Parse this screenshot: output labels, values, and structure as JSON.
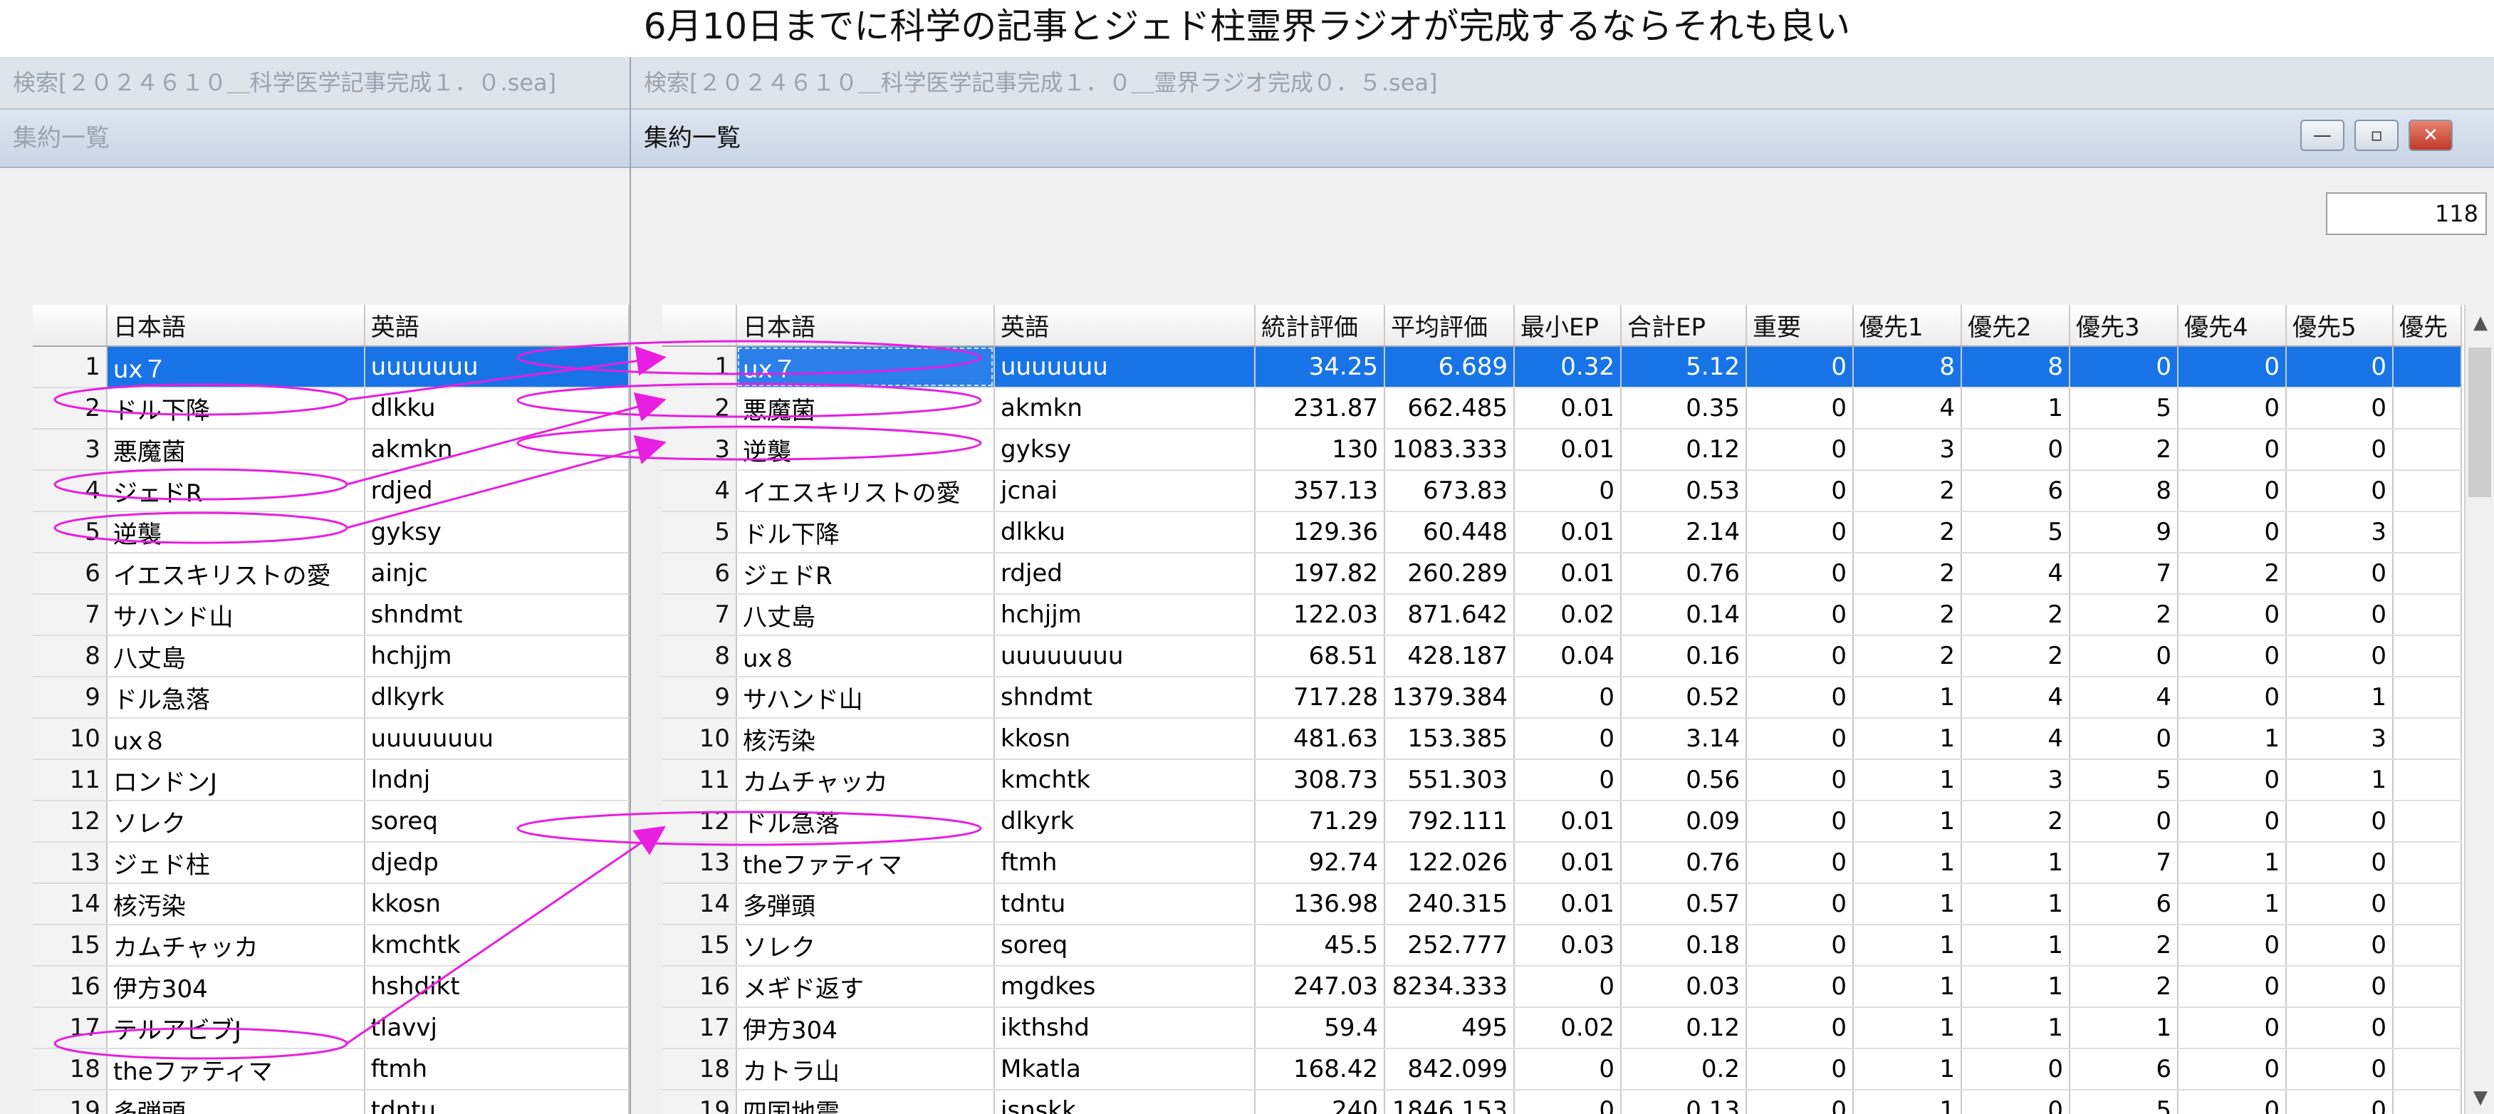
{
  "caption": "6月10日までに科学の記事とジェド柱霊界ラジオが完成するならそれも良い",
  "left_window": {
    "search_title": "検索[２０２４６１０＿科学医学記事完成１．０.sea]",
    "panel_title": "集約一覧",
    "columns": [
      "日本語",
      "英語"
    ],
    "rows": [
      {
        "n": "1",
        "jp": "ux７",
        "en": "uuuuuuu"
      },
      {
        "n": "2",
        "jp": "ドル下降",
        "en": "dlkku"
      },
      {
        "n": "3",
        "jp": "悪魔菌",
        "en": "akmkn"
      },
      {
        "n": "4",
        "jp": "ジェドR",
        "en": "rdjed"
      },
      {
        "n": "5",
        "jp": "逆襲",
        "en": "gyksy"
      },
      {
        "n": "6",
        "jp": "イエスキリストの愛",
        "en": "ainjc"
      },
      {
        "n": "7",
        "jp": "サハンド山",
        "en": "shndmt"
      },
      {
        "n": "8",
        "jp": "八丈島",
        "en": "hchjjm"
      },
      {
        "n": "9",
        "jp": "ドル急落",
        "en": "dlkyrk"
      },
      {
        "n": "10",
        "jp": "ux８",
        "en": "uuuuuuuu"
      },
      {
        "n": "11",
        "jp": "ロンドンJ",
        "en": "lndnj"
      },
      {
        "n": "12",
        "jp": "ソレク",
        "en": "soreq"
      },
      {
        "n": "13",
        "jp": "ジェド柱",
        "en": "djedp"
      },
      {
        "n": "14",
        "jp": "核汚染",
        "en": "kkosn"
      },
      {
        "n": "15",
        "jp": "カムチャッカ",
        "en": "kmchtk"
      },
      {
        "n": "16",
        "jp": "伊方304",
        "en": "hshdikt"
      },
      {
        "n": "17",
        "jp": "テルアビブJ",
        "en": "tlavvj"
      },
      {
        "n": "18",
        "jp": "theファティマ",
        "en": "ftmh"
      },
      {
        "n": "19",
        "jp": "多弾頭",
        "en": "tdntu"
      }
    ]
  },
  "right_window": {
    "search_title": "検索[２０２４６１０＿科学医学記事完成１．０＿霊界ラジオ完成０．５.sea]",
    "panel_title": "集約一覧",
    "count": "118",
    "columns": [
      "日本語",
      "英語",
      "統計評価",
      "平均評価",
      "最小EP",
      "合計EP",
      "重要",
      "優先1",
      "優先2",
      "優先3",
      "優先4",
      "優先5",
      "優先"
    ],
    "rows": [
      [
        "1",
        "ux７",
        "uuuuuuu",
        "34.25",
        "6.689",
        "0.32",
        "5.12",
        "0",
        "8",
        "8",
        "0",
        "0",
        "0"
      ],
      [
        "2",
        "悪魔菌",
        "akmkn",
        "231.87",
        "662.485",
        "0.01",
        "0.35",
        "0",
        "4",
        "1",
        "5",
        "0",
        "0"
      ],
      [
        "3",
        "逆襲",
        "gyksy",
        "130",
        "1083.333",
        "0.01",
        "0.12",
        "0",
        "3",
        "0",
        "2",
        "0",
        "0"
      ],
      [
        "4",
        "イエスキリストの愛",
        "jcnai",
        "357.13",
        "673.83",
        "0",
        "0.53",
        "0",
        "2",
        "6",
        "8",
        "0",
        "0"
      ],
      [
        "5",
        "ドル下降",
        "dlkku",
        "129.36",
        "60.448",
        "0.01",
        "2.14",
        "0",
        "2",
        "5",
        "9",
        "0",
        "3"
      ],
      [
        "6",
        "ジェドR",
        "rdjed",
        "197.82",
        "260.289",
        "0.01",
        "0.76",
        "0",
        "2",
        "4",
        "7",
        "2",
        "0"
      ],
      [
        "7",
        "八丈島",
        "hchjjm",
        "122.03",
        "871.642",
        "0.02",
        "0.14",
        "0",
        "2",
        "2",
        "2",
        "0",
        "0"
      ],
      [
        "8",
        "ux８",
        "uuuuuuuu",
        "68.51",
        "428.187",
        "0.04",
        "0.16",
        "0",
        "2",
        "2",
        "0",
        "0",
        "0"
      ],
      [
        "9",
        "サハンド山",
        "shndmt",
        "717.28",
        "1379.384",
        "0",
        "0.52",
        "0",
        "1",
        "4",
        "4",
        "0",
        "1"
      ],
      [
        "10",
        "核汚染",
        "kkosn",
        "481.63",
        "153.385",
        "0",
        "3.14",
        "0",
        "1",
        "4",
        "0",
        "1",
        "3"
      ],
      [
        "11",
        "カムチャッカ",
        "kmchtk",
        "308.73",
        "551.303",
        "0",
        "0.56",
        "0",
        "1",
        "3",
        "5",
        "0",
        "1"
      ],
      [
        "12",
        "ドル急落",
        "dlkyrk",
        "71.29",
        "792.111",
        "0.01",
        "0.09",
        "0",
        "1",
        "2",
        "0",
        "0",
        "0"
      ],
      [
        "13",
        "theファティマ",
        "ftmh",
        "92.74",
        "122.026",
        "0.01",
        "0.76",
        "0",
        "1",
        "1",
        "7",
        "1",
        "0"
      ],
      [
        "14",
        "多弾頭",
        "tdntu",
        "136.98",
        "240.315",
        "0.01",
        "0.57",
        "0",
        "1",
        "1",
        "6",
        "1",
        "0"
      ],
      [
        "15",
        "ソレク",
        "soreq",
        "45.5",
        "252.777",
        "0.03",
        "0.18",
        "0",
        "1",
        "1",
        "2",
        "0",
        "0"
      ],
      [
        "16",
        "メギド返す",
        "mgdkes",
        "247.03",
        "8234.333",
        "0",
        "0.03",
        "0",
        "1",
        "1",
        "2",
        "0",
        "0"
      ],
      [
        "17",
        "伊方304",
        "ikthshd",
        "59.4",
        "495",
        "0.02",
        "0.12",
        "0",
        "1",
        "1",
        "1",
        "0",
        "0"
      ],
      [
        "18",
        "カトラ山",
        "Mkatla",
        "168.42",
        "842.099",
        "0",
        "0.2",
        "0",
        "1",
        "0",
        "6",
        "0",
        "0"
      ],
      [
        "19",
        "四国地震",
        "jsnskk",
        "240",
        "1846.153",
        "0",
        "0.13",
        "0",
        "1",
        "0",
        "5",
        "0",
        "0"
      ]
    ]
  },
  "window_controls": {
    "minimize": "—",
    "maximize": "▫",
    "close": "✕"
  },
  "annotation_color": "#e81ee0"
}
